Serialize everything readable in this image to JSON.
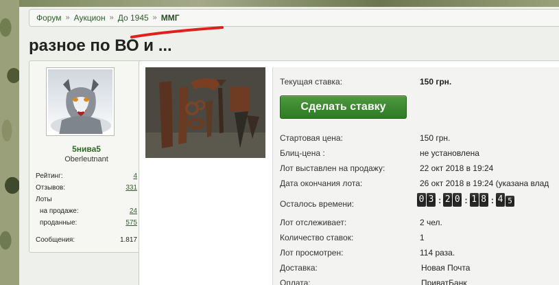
{
  "breadcrumb": {
    "items": [
      "Форум",
      "Аукцион",
      "До 1945"
    ],
    "current": "ММГ",
    "separator": "»"
  },
  "page_title": "разное по ВО и ...",
  "profile": {
    "username": "5нива5",
    "rank": "Oberleutnant",
    "stats": {
      "rating_label": "Рейтинг:",
      "rating": "4",
      "reviews_label": "Отзывов:",
      "reviews": "331",
      "lots_label": "Лоты",
      "on_sale_label": "на продаже:",
      "on_sale": "24",
      "sold_label": "проданные:",
      "sold": "575",
      "messages_label": "Сообщения:",
      "messages": "1.817"
    }
  },
  "lot": {
    "current_bid_label": "Текущая ставка:",
    "current_bid": "150 грн.",
    "bid_button": "Сделать ставку",
    "start_price_label": "Стартовая цена:",
    "start_price": "150 грн.",
    "blitz_label": "Блиц-цена :",
    "blitz": "не установлена",
    "listed_label": "Лот выставлен на продажу:",
    "listed": "22 окт 2018 в 19:24",
    "end_label": "Дата окончания лота:",
    "end": "26 окт 2018 в 19:24 (указана влад",
    "remaining_label": "Осталось времени:",
    "timer": {
      "d": [
        "0",
        "3"
      ],
      "h": [
        "2",
        "0"
      ],
      "m": [
        "1",
        "8"
      ],
      "s": [
        "4",
        "5"
      ]
    },
    "watching_label": "Лот отслеживает:",
    "watching": "2 чел.",
    "bids_label": "Количество ставок:",
    "bids": "1",
    "views_label": "Лот просмотрен:",
    "views": "114 раза.",
    "delivery_label": "Доставка:",
    "delivery": "Новая Почта",
    "payment_label": "Оплата:",
    "payment": "ПриватБанк"
  },
  "colors": {
    "accent": "#2f7a25",
    "link": "#2e5a2b",
    "annotation": "#e0201c"
  }
}
